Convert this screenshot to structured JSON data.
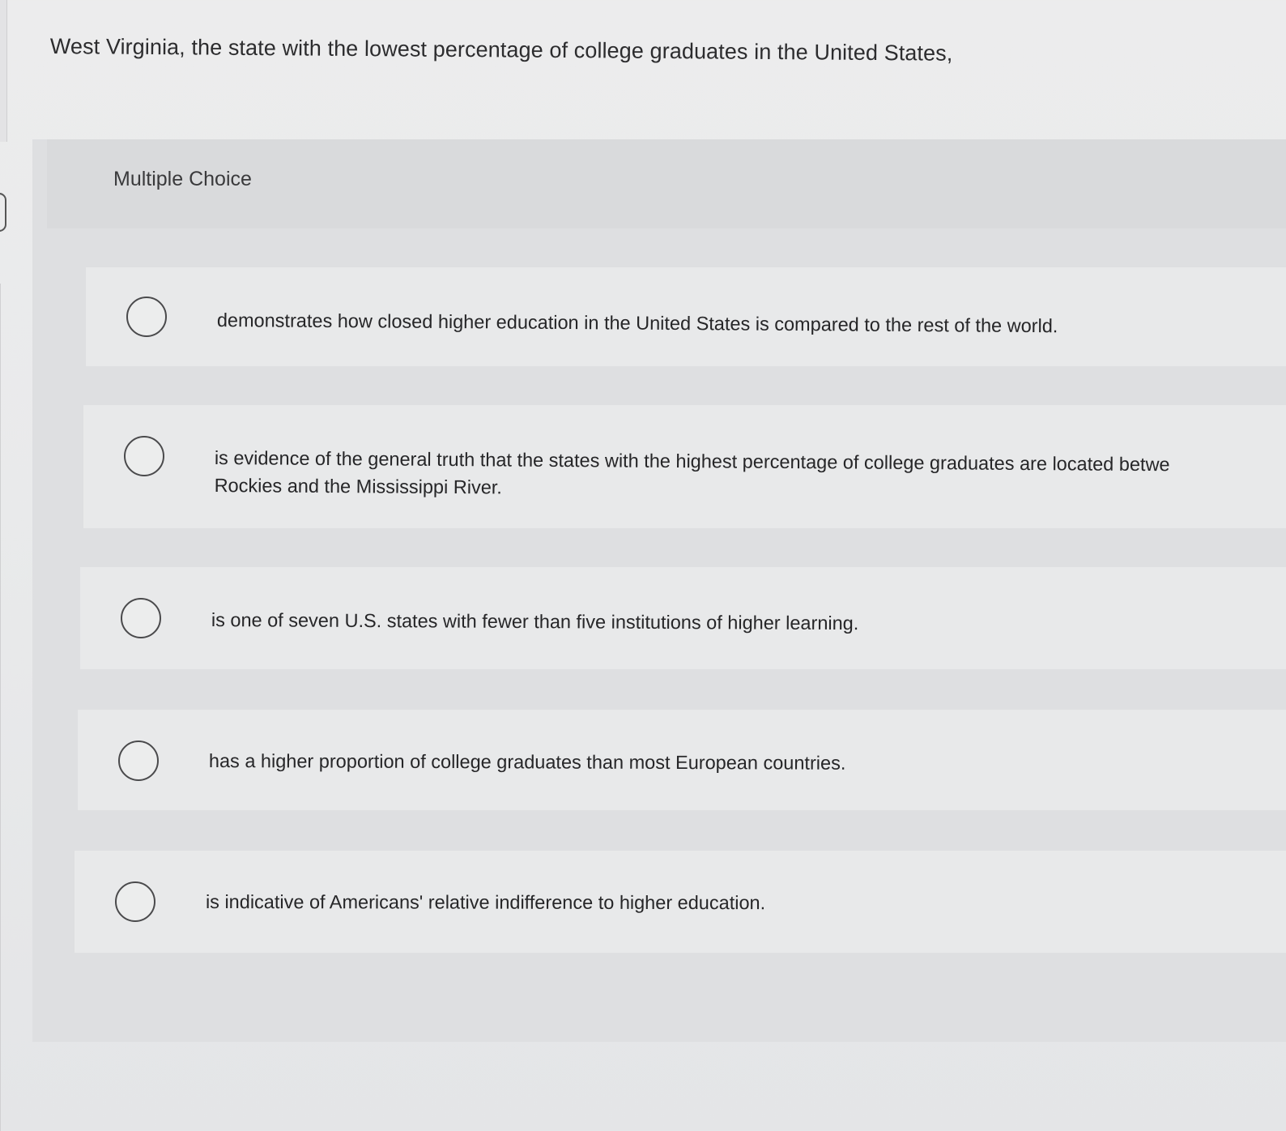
{
  "question": {
    "text": "West Virginia, the state with the lowest percentage of college graduates in the United States,"
  },
  "answer_panel": {
    "label": "Multiple Choice",
    "options": [
      {
        "lines": [
          "demonstrates how closed higher education in the United States is compared to the rest of the world."
        ],
        "selected": false
      },
      {
        "lines": [
          "is evidence of the general truth that the states with the highest percentage of college graduates are located betwe",
          "Rockies and the Mississippi River."
        ],
        "selected": false
      },
      {
        "lines": [
          "is one of seven U.S. states with fewer than five institutions of higher learning."
        ],
        "selected": false
      },
      {
        "lines": [
          "has a higher proportion of college graduates than most European countries."
        ],
        "selected": false
      },
      {
        "lines": [
          "is indicative of Americans' relative indifference to higher education."
        ],
        "selected": false
      }
    ]
  }
}
